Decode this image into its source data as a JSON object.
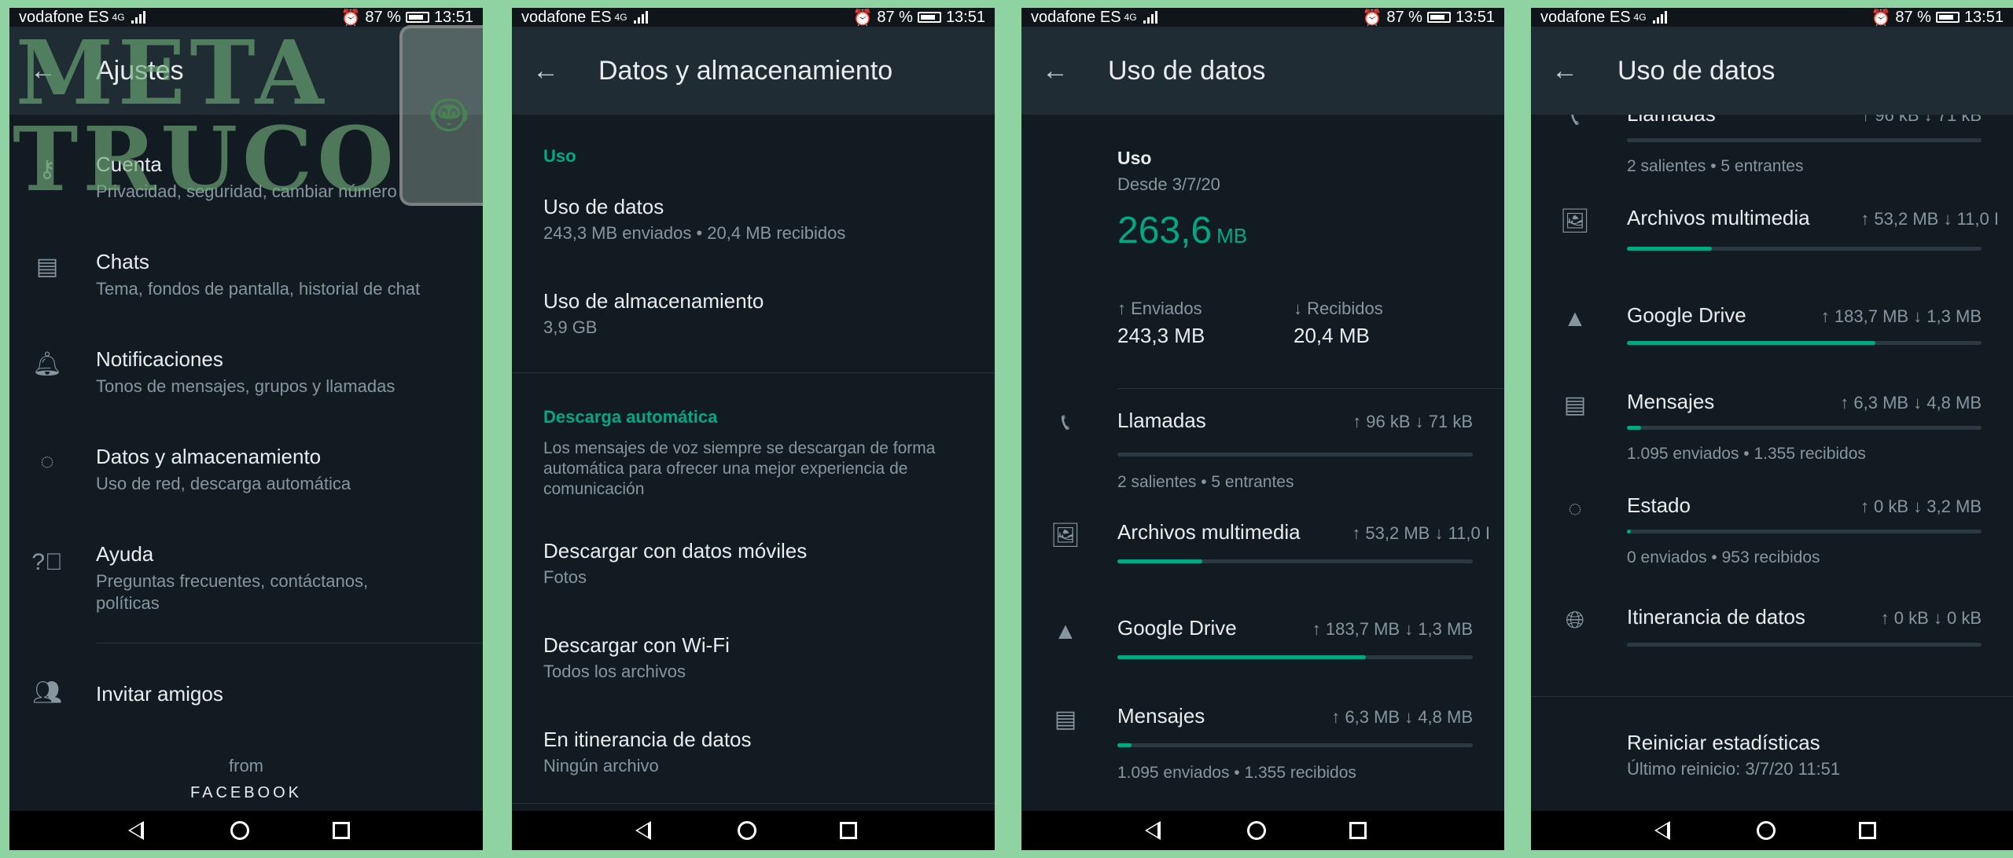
{
  "status": {
    "carrier": "vodafone ES",
    "net": "4G",
    "battery": "87 %",
    "time": "13:51"
  },
  "panel1": {
    "title": "Ajustes",
    "watermark": {
      "line1": "META",
      "line2": "TRUCO"
    },
    "items": [
      {
        "icon": "key-icon",
        "title": "Cuenta",
        "subtitle": "Privacidad, seguridad, cambiar número"
      },
      {
        "icon": "chat-icon",
        "title": "Chats",
        "subtitle": "Tema, fondos de pantalla, historial de chat"
      },
      {
        "icon": "bell-icon",
        "title": "Notificaciones",
        "subtitle": "Tonos de mensajes, grupos y llamadas"
      },
      {
        "icon": "data-circle-icon",
        "title": "Datos y almacenamiento",
        "subtitle": "Uso de red, descarga automática"
      },
      {
        "icon": "help-icon",
        "title": "Ayuda",
        "subtitle": "Preguntas frecuentes, contáctanos, políticas"
      },
      {
        "icon": "people-icon",
        "title": "Invitar amigos",
        "subtitle": ""
      }
    ],
    "from": "from",
    "brand": "FACEBOOK"
  },
  "panel2": {
    "title": "Datos y almacenamiento",
    "section1": "Uso",
    "uso_datos": {
      "title": "Uso de datos",
      "subtitle": "243,3 MB enviados • 20,4 MB recibidos"
    },
    "uso_alm": {
      "title": "Uso de almacenamiento",
      "subtitle": "3,9 GB"
    },
    "section2": "Descarga automática",
    "description": "Los mensajes de voz siempre se descargan de forma automática para ofrecer una mejor experiencia de comunicación",
    "moviles": {
      "title": "Descargar con datos móviles",
      "subtitle": "Fotos"
    },
    "wifi": {
      "title": "Descargar con Wi-Fi",
      "subtitle": "Todos los archivos"
    },
    "roaming": {
      "title": "En itinerancia de datos",
      "subtitle": "Ningún archivo"
    }
  },
  "panel3": {
    "title": "Uso de datos",
    "uso_label": "Uso",
    "since": "Desde 3/7/20",
    "total_value": "263,6",
    "total_unit": "MB",
    "sent_label": "↑ Enviados",
    "sent_value": "243,3 MB",
    "recv_label": "↓ Recibidos",
    "recv_value": "20,4 MB",
    "categories": [
      {
        "icon": "phone-icon",
        "name": "Llamadas",
        "vals": "↑ 96 kB   ↓ 71 kB",
        "fill": 0,
        "sub": "2 salientes • 5 entrantes"
      },
      {
        "icon": "media-icon",
        "name": "Archivos multimedia",
        "vals": "↑ 53,2 MB   ↓ 11,0 I",
        "fill": 0.24,
        "sub": ""
      },
      {
        "icon": "drive-icon",
        "name": "Google Drive",
        "vals": "↑ 183,7 MB   ↓ 1,3 MB",
        "fill": 0.7,
        "sub": ""
      },
      {
        "icon": "message-icon",
        "name": "Mensajes",
        "vals": "↑ 6,3 MB   ↓ 4,8 MB",
        "fill": 0.04,
        "sub": "1.095 enviados • 1.355 recibidos"
      }
    ]
  },
  "panel4": {
    "title": "Uso de datos",
    "top_partial": "Llamadas",
    "top_partial_vals": "↑ 96 kB   ↓ 71 kB",
    "top_sub": "2 salientes • 5 entrantes",
    "categories": [
      {
        "icon": "media-icon",
        "name": "Archivos multimedia",
        "vals": "↑ 53,2 MB   ↓ 11,0 I",
        "fill": 0.24,
        "sub": ""
      },
      {
        "icon": "drive-icon",
        "name": "Google Drive",
        "vals": "↑ 183,7 MB   ↓ 1,3 MB",
        "fill": 0.7,
        "sub": ""
      },
      {
        "icon": "message-icon",
        "name": "Mensajes",
        "vals": "↑ 6,3 MB   ↓ 4,8 MB",
        "fill": 0.04,
        "sub": "1.095 enviados • 1.355 recibidos"
      },
      {
        "icon": "status-circle-icon",
        "name": "Estado",
        "vals": "↑ 0 kB   ↓ 3,2 MB",
        "fill": 0.01,
        "sub": "0 enviados • 953 recibidos"
      },
      {
        "icon": "globe-icon",
        "name": "Itinerancia de datos",
        "vals": "↑ 0 kB   ↓ 0 kB",
        "fill": 0,
        "sub": ""
      }
    ],
    "reset": {
      "title": "Reiniciar estadísticas",
      "subtitle": "Último reinicio: 3/7/20 11:51"
    }
  }
}
